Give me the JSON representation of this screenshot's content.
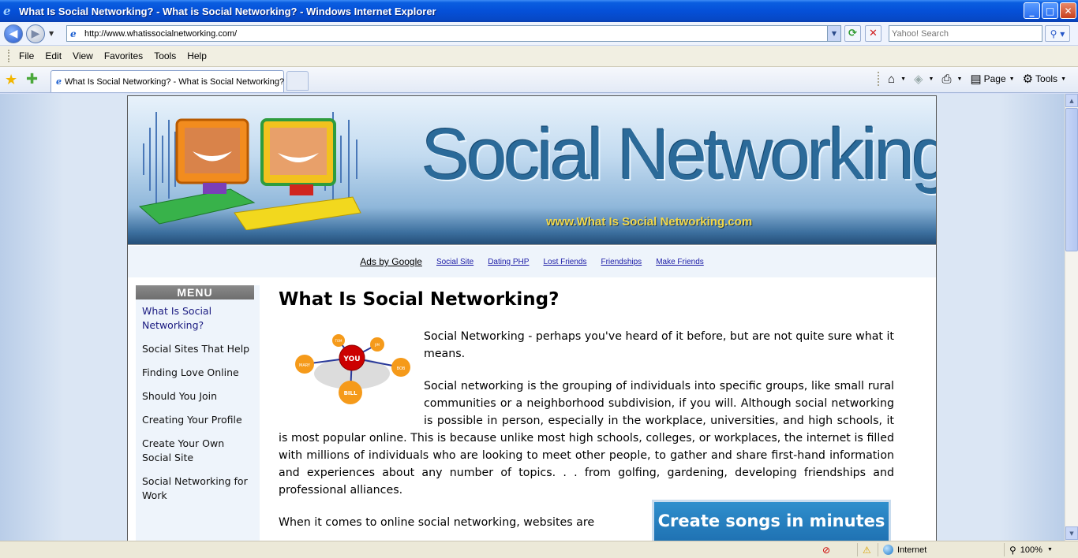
{
  "window": {
    "title": "What Is Social Networking? - What is Social Networking? - Windows Internet Explorer",
    "min": "_",
    "max": "□",
    "close": "✕"
  },
  "address": {
    "url": "http://www.whatissocialnetworking.com/",
    "search_placeholder": "Yahoo! Search"
  },
  "menu": [
    "File",
    "Edit",
    "View",
    "Favorites",
    "Tools",
    "Help"
  ],
  "tab": {
    "title": "What Is Social Networking? - What is Social Networking?"
  },
  "commandbar": {
    "page_label": "Page",
    "tools_label": "Tools"
  },
  "banner": {
    "headline": "Social Networking",
    "url": "www.What Is Social Networking.com"
  },
  "ads": {
    "label": "Ads by Google",
    "links": [
      "Social Site",
      "Dating PHP",
      "Lost Friends",
      "Friendships",
      "Make Friends"
    ]
  },
  "sidebar": {
    "header": "MENU",
    "items": [
      "What Is Social Networking?",
      "Social Sites That Help",
      "Finding Love Online",
      "Should You Join",
      "Creating Your Profile",
      "Create Your Own Social Site",
      "Social Networking for Work"
    ]
  },
  "article": {
    "title": "What Is Social Networking?",
    "p1": "Social Networking - perhaps you've heard of it before, but are not quite sure what it means.",
    "p2": "Social networking is the grouping of individuals into specific groups, like small rural communities or a neighborhood subdivision, if you will. Although social networking is possible in person, especially in the workplace, universities, and high schools, it is most popular online. This is because unlike most high schools, colleges, or workplaces, the internet is filled with millions of individuals who are looking to meet other people, to gather and share first-hand information and experiences about any number of topics. . . from golfing, gardening, developing friendships and professional alliances.",
    "p3": "When it comes to online social networking, websites are",
    "graphic_labels": {
      "center": "YOU",
      "n1": "MARY",
      "n2": "TOM",
      "n3": "JIM",
      "n4": "BOB",
      "n5": "BILL"
    }
  },
  "ad": {
    "text": "Create songs in minutes"
  },
  "status": {
    "zone": "Internet",
    "zoom": "100%"
  },
  "colors": {
    "titlebar": "#0550d8",
    "link": "#1a1aa6",
    "banner_text": "#2b6a99",
    "ad_bg": "#1e6fb0"
  }
}
